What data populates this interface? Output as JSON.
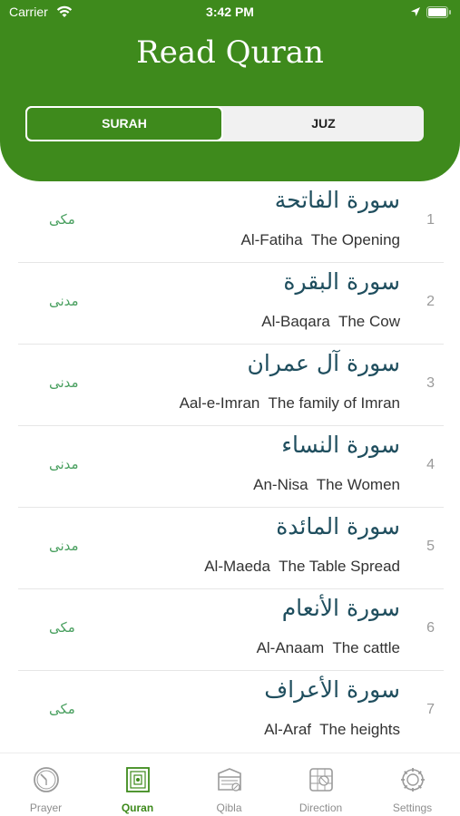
{
  "status_bar": {
    "carrier": "Carrier",
    "time": "3:42 PM"
  },
  "header": {
    "title": "Read Quran"
  },
  "segments": {
    "surah": "SURAH",
    "juz": "JUZ",
    "selected": "SURAH"
  },
  "colors": {
    "brand_green": "#3e8a1c",
    "type_green": "#4aa060",
    "arabic_text": "#1f4e5e"
  },
  "surahs": [
    {
      "number": "1",
      "arabic": "سورة الفاتحة",
      "english": "Al-Fatiha  The Opening",
      "type": "مکی"
    },
    {
      "number": "2",
      "arabic": "سورة البقرة",
      "english": "Al-Baqara  The Cow",
      "type": "مدنی"
    },
    {
      "number": "3",
      "arabic": "سورة آل عمران",
      "english": "Aal-e-Imran  The family of Imran",
      "type": "مدنی"
    },
    {
      "number": "4",
      "arabic": "سورة النساء",
      "english": "An-Nisa  The Women",
      "type": "مدنی"
    },
    {
      "number": "5",
      "arabic": "سورة المائدة",
      "english": "Al-Maeda  The Table Spread",
      "type": "مدنی"
    },
    {
      "number": "6",
      "arabic": "سورة الأنعام",
      "english": "Al-Anaam  The cattle",
      "type": "مکی"
    },
    {
      "number": "7",
      "arabic": "سورة الأعراف",
      "english": "Al-Araf  The heights",
      "type": "مکی"
    }
  ],
  "tabs": [
    {
      "label": "Prayer",
      "icon": "clock-icon"
    },
    {
      "label": "Quran",
      "icon": "quran-icon"
    },
    {
      "label": "Qibla",
      "icon": "kaaba-icon"
    },
    {
      "label": "Direction",
      "icon": "map-icon"
    },
    {
      "label": "Settings",
      "icon": "gear-icon"
    }
  ],
  "active_tab": "Quran"
}
